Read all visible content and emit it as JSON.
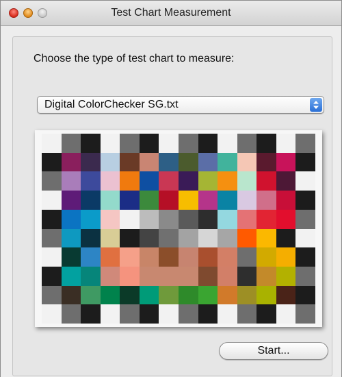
{
  "window": {
    "title": "Test Chart Measurement"
  },
  "prompt": "Choose the type of test chart to measure:",
  "chart_type_popup": {
    "selected": "Digital ColorChecker SG.txt",
    "icon": "up-down-arrows-icon"
  },
  "color_chart": {
    "rows": [
      [
        "#f2f2f2",
        "#6e6e6e",
        "#1c1c1c",
        "#f2f2f2",
        "#6e6e6e",
        "#1c1c1c",
        "#f2f2f2",
        "#6e6e6e",
        "#1c1c1c",
        "#f2f2f2",
        "#6e6e6e",
        "#1c1c1c",
        "#f2f2f2",
        "#6e6e6e"
      ],
      [
        "#1c1c1c",
        "#8a1f5d",
        "#3b2a4e",
        "#b8cfe2",
        "#6a3a26",
        "#c98573",
        "#2d5f86",
        "#4b5b2d",
        "#5b6ea7",
        "#41b39c",
        "#f5c7b5",
        "#5a1a2e",
        "#c8135a",
        "#1c1c1c"
      ],
      [
        "#6e6e6e",
        "#a97dba",
        "#3d4a9c",
        "#ebc1d1",
        "#f07a0e",
        "#0e4fa2",
        "#c93754",
        "#3a1b57",
        "#a5b534",
        "#f59010",
        "#b9e6cd",
        "#d0122e",
        "#4d1836",
        "#f2f2f2"
      ],
      [
        "#f2f2f2",
        "#5e1b78",
        "#0b3a66",
        "#93dacb",
        "#1b2d86",
        "#3c8a3c",
        "#b50f26",
        "#f7bd00",
        "#b5348a",
        "#0a83a4",
        "#d9c9e2",
        "#d06f8a",
        "#c80f38",
        "#1c1c1c"
      ],
      [
        "#1c1c1c",
        "#0b74c2",
        "#0b9bc9",
        "#f5c6c3",
        "#f2f2f2",
        "#bcbcbc",
        "#8a8a8a",
        "#5a5a5a",
        "#2d2d2d",
        "#94d8e0",
        "#e47275",
        "#e22433",
        "#e20e2d",
        "#6e6e6e"
      ],
      [
        "#6e6e6e",
        "#0e99c0",
        "#0b3141",
        "#d8cd96",
        "#1c1c1c",
        "#444444",
        "#707070",
        "#a3a3a3",
        "#d6d6d6",
        "#a6a6a6",
        "#ff5a00",
        "#fbb800",
        "#1c1c1c",
        "#f2f2f2"
      ],
      [
        "#f2f2f2",
        "#083a32",
        "#2d85c5",
        "#e07040",
        "#f5a089",
        "#c88568",
        "#8b4e2a",
        "#c78470",
        "#a94f2e",
        "#d37f66",
        "#6e6e6e",
        "#d2aa00",
        "#f5ae00",
        "#1c1c1c"
      ],
      [
        "#1c1c1c",
        "#02a1a0",
        "#06857a",
        "#d0897a",
        "#f5937e",
        "#c88870",
        "#c88870",
        "#c88870",
        "#7f4a2f",
        "#d27f68",
        "#2e2e2e",
        "#c38a2a",
        "#b3b100",
        "#6e6e6e"
      ],
      [
        "#6e6e6e",
        "#3a2e24",
        "#3f9a63",
        "#00824c",
        "#0b3a28",
        "#009b78",
        "#6f9a3b",
        "#2e8a2a",
        "#3aa531",
        "#d17a2a",
        "#9d8f25",
        "#a9b200",
        "#4a2318",
        "#1c1c1c"
      ],
      [
        "#f2f2f2",
        "#6e6e6e",
        "#1c1c1c",
        "#f2f2f2",
        "#6e6e6e",
        "#1c1c1c",
        "#f2f2f2",
        "#6e6e6e",
        "#1c1c1c",
        "#f2f2f2",
        "#6e6e6e",
        "#1c1c1c",
        "#f2f2f2",
        "#6e6e6e"
      ]
    ]
  },
  "start_button": {
    "label": "Start..."
  }
}
